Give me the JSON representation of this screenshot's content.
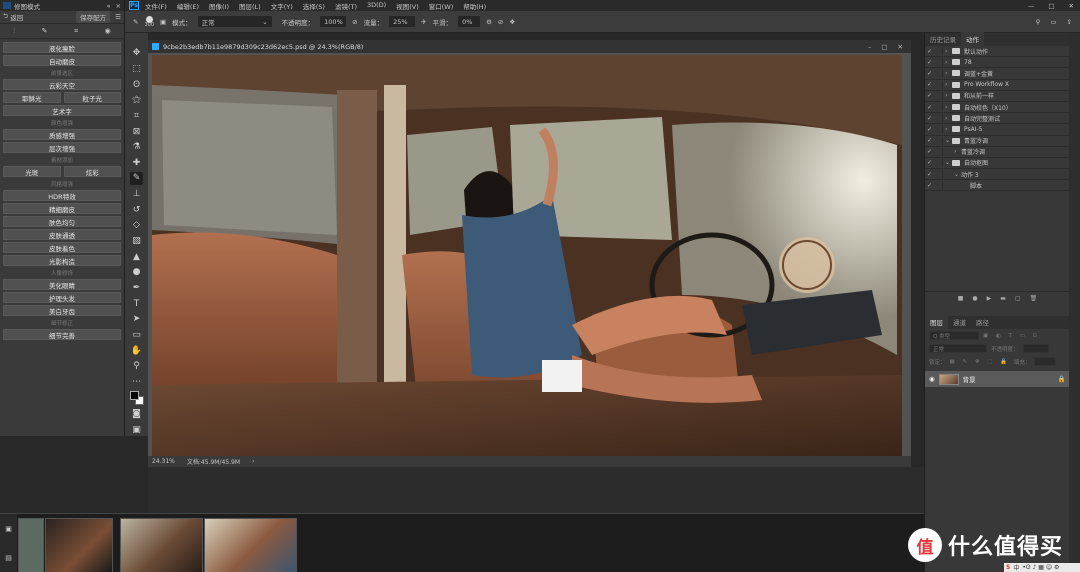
{
  "plugin_panel": {
    "title": "修图模式",
    "back_label": "返回",
    "save_label": "保存配方",
    "items": [
      {
        "type": "button",
        "label": "液化瘦脸"
      },
      {
        "type": "button",
        "label": "自动磨皮"
      },
      {
        "type": "section",
        "label": "前景选区"
      },
      {
        "type": "button",
        "label": "云彩天空"
      },
      {
        "type": "pair",
        "labels": [
          "耶稣光",
          "粒子光"
        ]
      },
      {
        "type": "button",
        "label": "艺术字"
      },
      {
        "type": "section",
        "label": "颜色增强"
      },
      {
        "type": "button",
        "label": "质感增强"
      },
      {
        "type": "button",
        "label": "层次增强"
      },
      {
        "type": "section",
        "label": "素材添加"
      },
      {
        "type": "pair",
        "labels": [
          "光斑",
          "炫彩"
        ]
      },
      {
        "type": "section",
        "label": "风格增强"
      },
      {
        "type": "button",
        "label": "HDR特效"
      },
      {
        "type": "button",
        "label": "精细磨皮"
      },
      {
        "type": "button",
        "label": "肤色均匀"
      },
      {
        "type": "button",
        "label": "皮肤通透"
      },
      {
        "type": "button",
        "label": "皮肤着色"
      },
      {
        "type": "button",
        "label": "光影构造"
      },
      {
        "type": "section",
        "label": "人像修饰"
      },
      {
        "type": "button",
        "label": "美化眼睛"
      },
      {
        "type": "button",
        "label": "护理头发"
      },
      {
        "type": "button",
        "label": "美白牙齿"
      },
      {
        "type": "section",
        "label": "细节修正"
      },
      {
        "type": "button",
        "label": "细节完善"
      }
    ]
  },
  "menu_bar": {
    "app_badge": "Ps",
    "items": [
      "文件(F)",
      "编辑(E)",
      "图像(I)",
      "图层(L)",
      "文字(Y)",
      "选择(S)",
      "滤镜(T)",
      "3D(D)",
      "视图(V)",
      "窗口(W)",
      "帮助(H)"
    ]
  },
  "options_bar": {
    "brush_size": "300",
    "mode_label": "模式：",
    "mode_value": "正常",
    "opacity_label": "不透明度：",
    "opacity_value": "100%",
    "flow_label": "流量：",
    "flow_value": "25%",
    "smooth_label": "平滑：",
    "smooth_value": "0%"
  },
  "document": {
    "tab_title": "9cbe2b3edb7b11e9879d309c23d62ec5.psd @ 24.3%(RGB/8)",
    "status_zoom": "24.31%",
    "status_doc": "文档:45.9M/45.9M"
  },
  "actions_panel": {
    "tabs": [
      "历史记录",
      "动作"
    ],
    "active_tab": "动作",
    "rows": [
      {
        "label": "默认动作",
        "indent": 0,
        "kind": "folder"
      },
      {
        "label": "78",
        "indent": 0,
        "kind": "folder"
      },
      {
        "label": "调蓝+金黄",
        "indent": 0,
        "kind": "folder"
      },
      {
        "label": "Pro Workflow X",
        "indent": 0,
        "kind": "folder"
      },
      {
        "label": "和从前一样",
        "indent": 0,
        "kind": "folder"
      },
      {
        "label": "自动校色（X10）",
        "indent": 0,
        "kind": "folder"
      },
      {
        "label": "自动完整测试",
        "indent": 0,
        "kind": "folder"
      },
      {
        "label": "PsAI-5",
        "indent": 0,
        "kind": "folder"
      },
      {
        "label": "青蓝冷调",
        "indent": 0,
        "kind": "folder-open"
      },
      {
        "label": "青蓝冷调",
        "indent": 1,
        "kind": "action"
      },
      {
        "label": "自动抠图",
        "indent": 0,
        "kind": "folder-open"
      },
      {
        "label": "动作 3",
        "indent": 1,
        "kind": "action-open"
      },
      {
        "label": "脚本",
        "indent": 2,
        "kind": "step"
      }
    ]
  },
  "layers_panel": {
    "tabs": [
      "图层",
      "通道",
      "路径"
    ],
    "active_tab": "图层",
    "filter_label": "Q 类型",
    "blend_mode": "正常",
    "opacity_label": "不透明度：",
    "lock_label": "锁定：",
    "fill_label": "填充：",
    "layer_name": "背景"
  },
  "watermark": {
    "logo_text": "值",
    "text": "什么值得买"
  },
  "ime_bar": {
    "label": "中"
  }
}
